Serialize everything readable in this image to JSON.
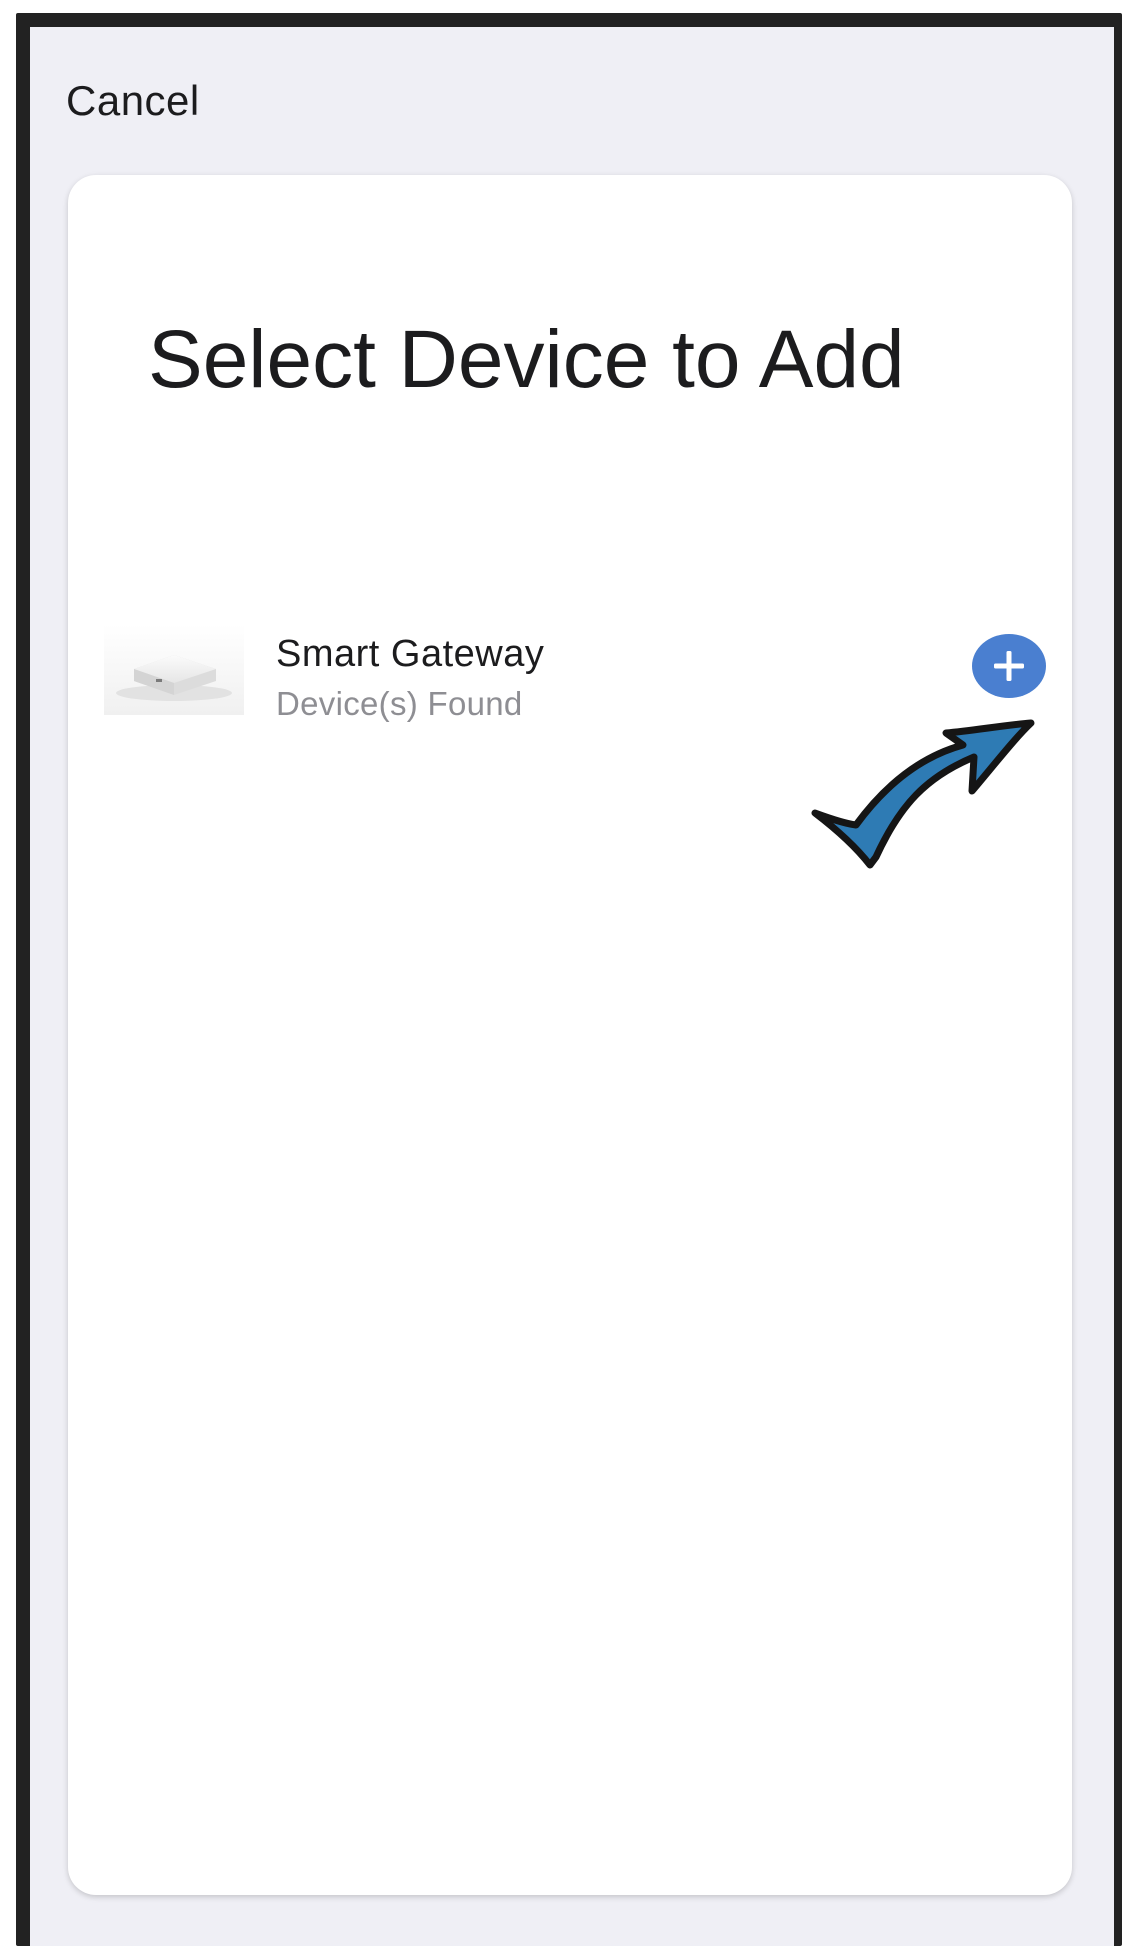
{
  "header": {
    "cancel_label": "Cancel"
  },
  "main": {
    "title": "Select Device to Add",
    "devices": [
      {
        "name": "Smart Gateway",
        "status": "Device(s) Found",
        "icon": "gateway-device-image",
        "action_icon": "plus-icon"
      }
    ]
  },
  "annotation": {
    "icon": "pointer-arrow",
    "color": "#2e7bb4"
  },
  "colors": {
    "background": "#efeff5",
    "card": "#ffffff",
    "accent": "#4a7fd0",
    "primary_text": "#1c1c1e",
    "secondary_text": "#8e8e93"
  }
}
